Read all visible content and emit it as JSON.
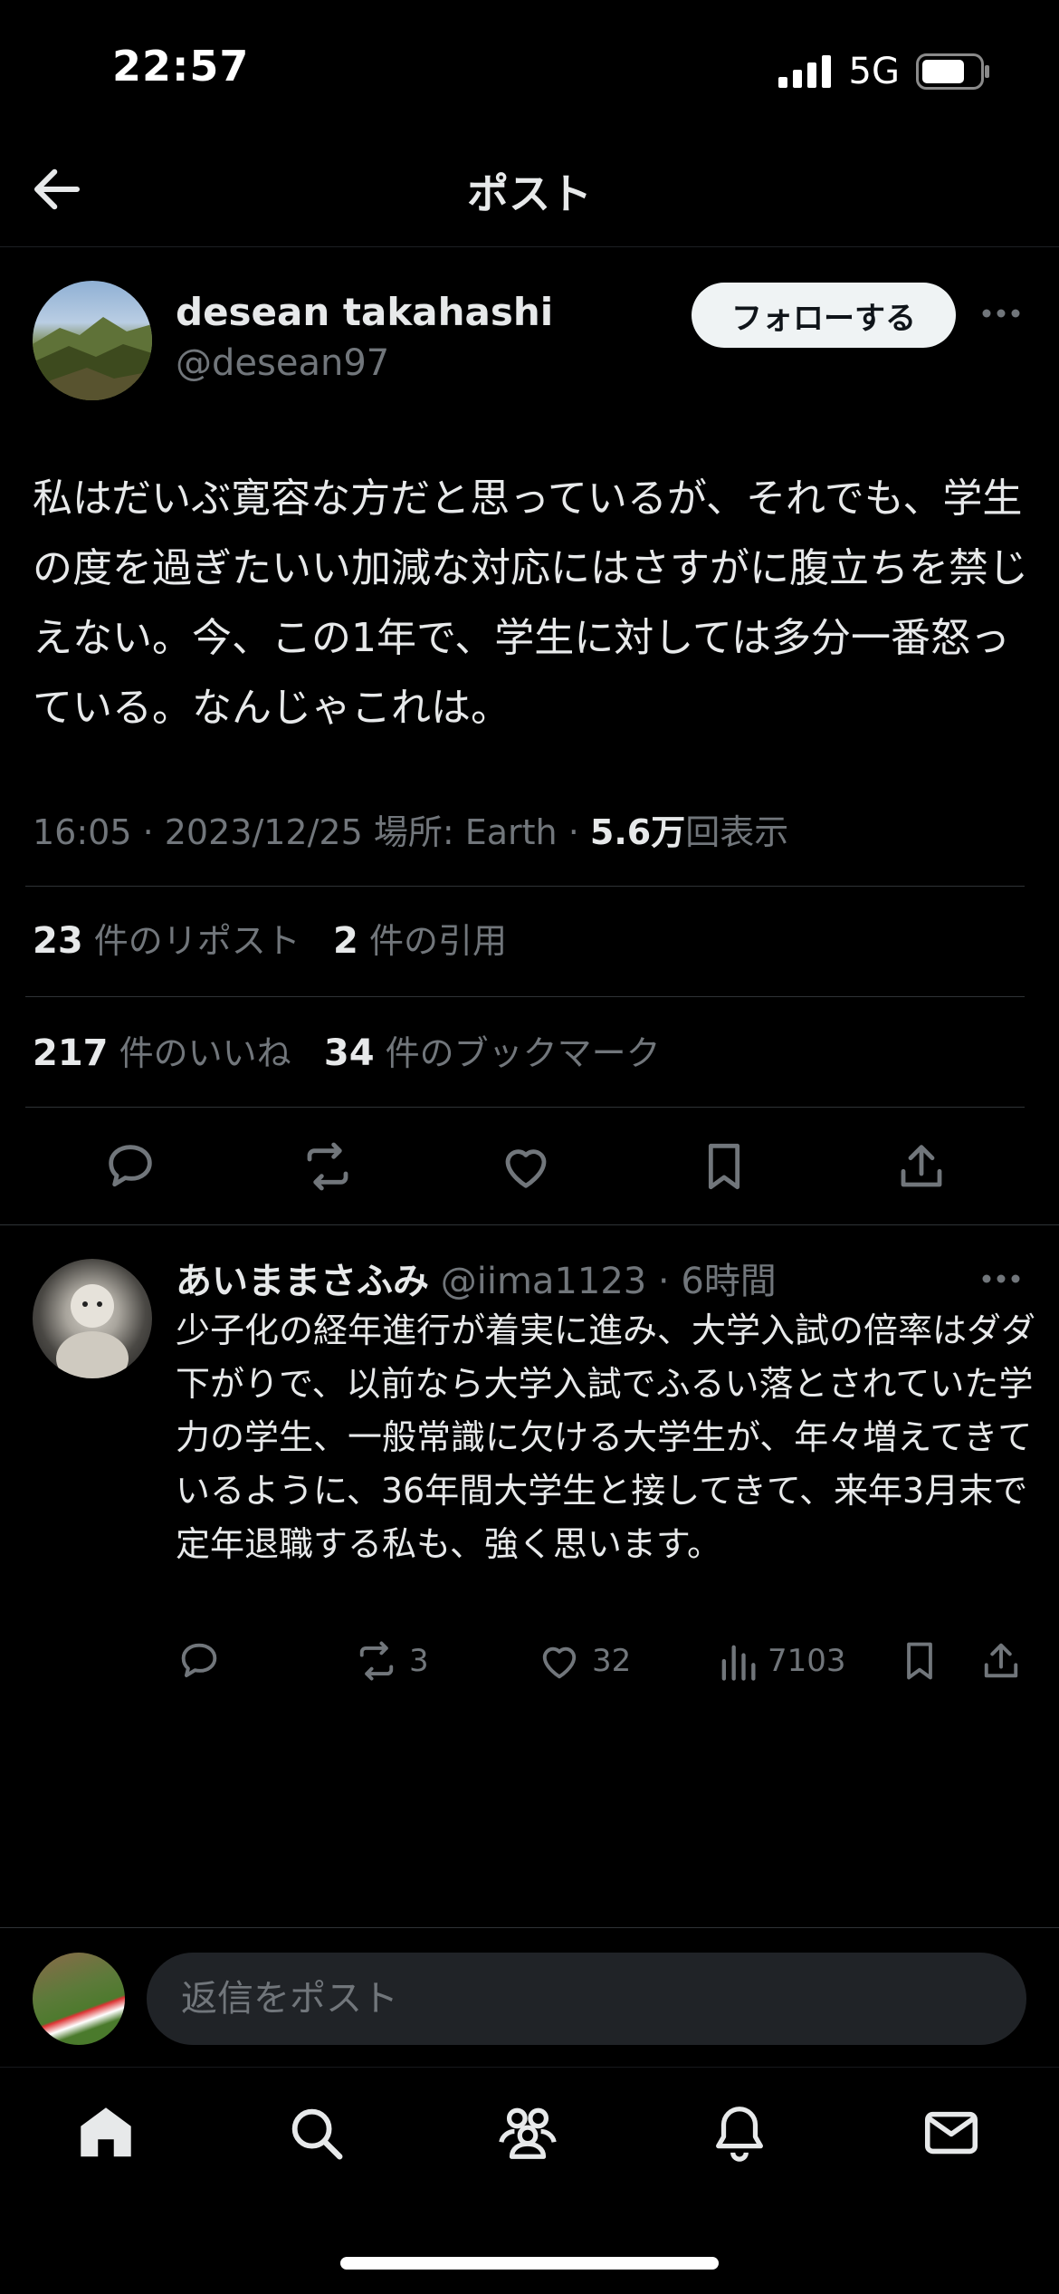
{
  "status_bar": {
    "time": "22:57",
    "network": "5G"
  },
  "header": {
    "title": "ポスト"
  },
  "post": {
    "author_name": "desean takahashi",
    "author_handle": "@desean97",
    "follow_label": "フォローする",
    "text": "私はだいぶ寛容な方だと思っているが、それでも、学生の度を過ぎたいい加減な対応にはさすがに腹立ちを禁じえない。今、この1年で、学生に対しては多分一番怒っている。なんじゃこれは。",
    "meta_prefix": "16:05 · 2023/12/25 場所: Earth · ",
    "views_count": "5.6万",
    "views_label": "回表示",
    "reposts_count": "23",
    "reposts_label": "件のリポスト",
    "quotes_count": "2",
    "quotes_label": "件の引用",
    "likes_count": "217",
    "likes_label": "件のいいね",
    "bookmarks_count": "34",
    "bookmarks_label": "件のブックマーク"
  },
  "reply": {
    "author_name": "あいままさふみ",
    "handle_time": "@iima1123 · 6時間",
    "text": "少子化の経年進行が着実に進み、大学入試の倍率はダダ下がりで、以前なら大学入試でふるい落とされていた学力の学生、一般常識に欠ける大学生が、年々増えてきているように、36年間大学生と接してきて、来年3月末で定年退職する私も、強く思います。",
    "retweets": "3",
    "likes": "32",
    "views": "7103"
  },
  "composer": {
    "placeholder": "返信をポスト"
  },
  "icons": {
    "back": "arrow-left-icon",
    "more": "more-dots-icon",
    "reply": "reply-icon",
    "repost": "repost-icon",
    "like": "heart-icon",
    "bookmark": "bookmark-icon",
    "share": "share-icon",
    "views": "views-icon",
    "tabs": [
      "home-icon",
      "search-icon",
      "communities-icon",
      "notifications-icon",
      "messages-icon"
    ]
  },
  "colors": {
    "background": "#000000",
    "text": "#e7e9ea",
    "muted": "#71767b",
    "follow_bg": "#eff3f4"
  }
}
